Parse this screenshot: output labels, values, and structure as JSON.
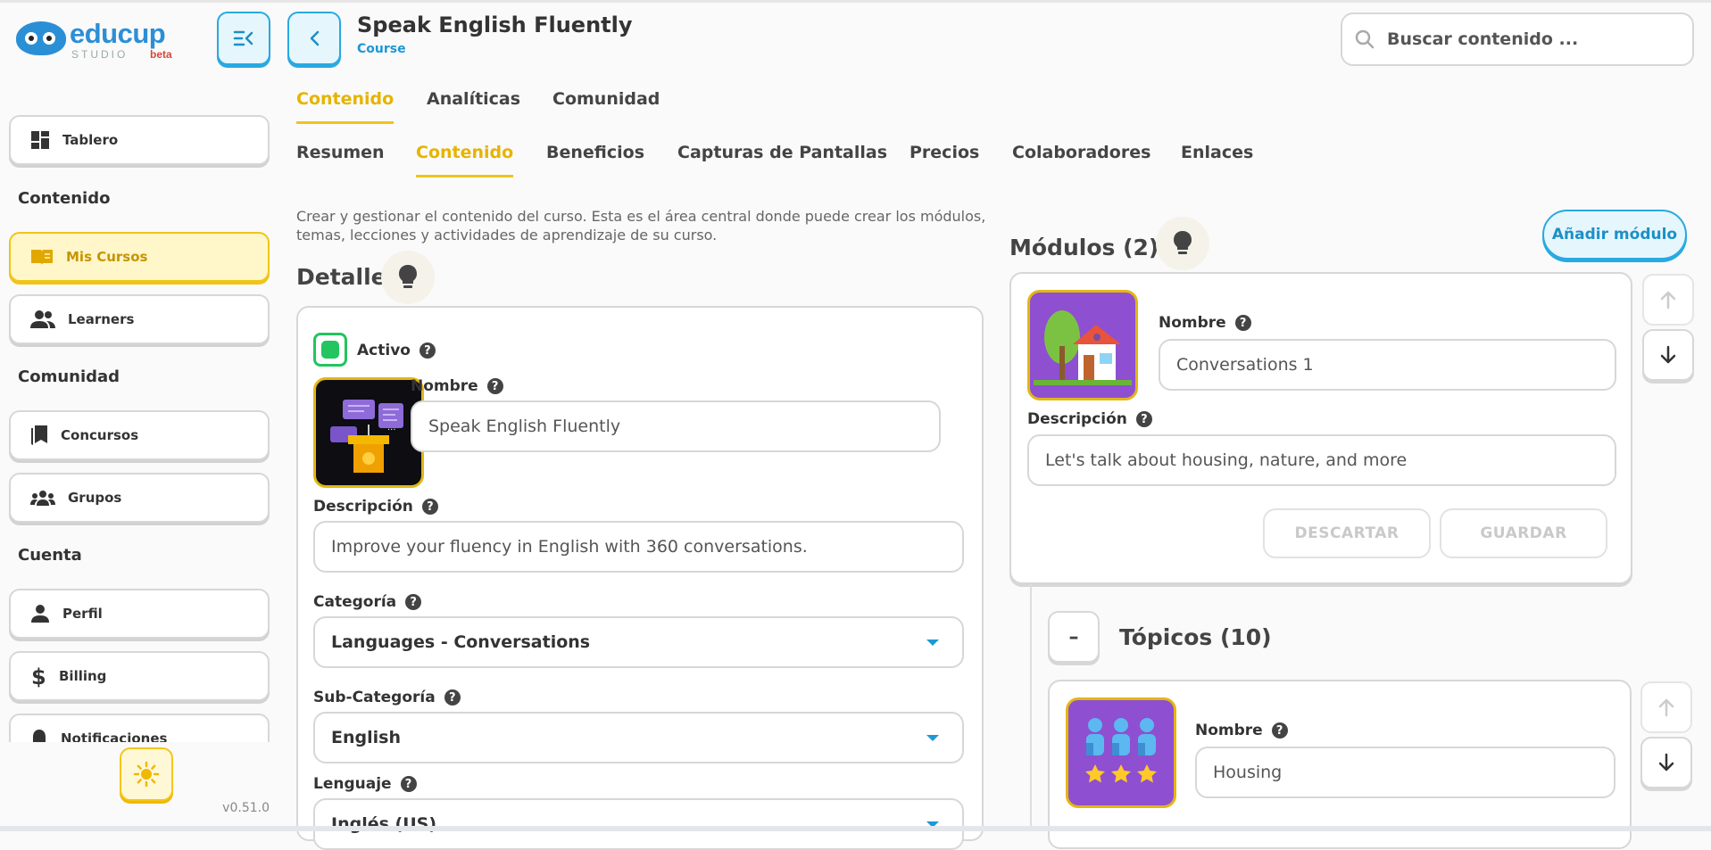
{
  "app": {
    "logo_text": "educup",
    "logo_sub": "STUDIO",
    "logo_badge": "beta",
    "version": "v0.51.0"
  },
  "header": {
    "title": "Speak English Fluently",
    "subtitle": "Course",
    "search_placeholder": "Buscar contenido ..."
  },
  "sidebar": {
    "items": [
      {
        "label": "Tablero",
        "icon": "dashboard-icon"
      },
      {
        "section": "Contenido"
      },
      {
        "label": "Mis Cursos",
        "icon": "book-icon",
        "active": true
      },
      {
        "label": "Learners",
        "icon": "people-icon"
      },
      {
        "section": "Comunidad"
      },
      {
        "label": "Concursos",
        "icon": "bookmark-icon"
      },
      {
        "label": "Grupos",
        "icon": "groups-icon"
      },
      {
        "section": "Cuenta"
      },
      {
        "label": "Perfil",
        "icon": "person-icon"
      },
      {
        "label": "Billing",
        "icon": "dollar-icon"
      },
      {
        "label": "Notificaciones",
        "icon": "bell-icon"
      }
    ]
  },
  "tabs": [
    "Contenido",
    "Analíticas",
    "Comunidad"
  ],
  "subtabs": [
    "Resumen",
    "Contenido",
    "Beneficios",
    "Capturas de Pantallas",
    "Precios",
    "Colaboradores",
    "Enlaces"
  ],
  "description": "Crear y gestionar el contenido del curso. Esta es el área central donde puede crear los módulos, temas, lecciones y actividades de aprendizaje de su curso.",
  "details": {
    "heading": "Detalles",
    "active_label": "Activo",
    "name_label": "Nombre",
    "name_value": "Speak English Fluently",
    "description_label": "Descripción",
    "description_value": "Improve your fluency in English with 360 conversations.",
    "category_label": "Categoría",
    "category_value": "Languages - Conversations",
    "subcategory_label": "Sub-Categoría",
    "subcategory_value": "English",
    "language_label": "Lenguaje",
    "language_value": "Inglés (US)"
  },
  "modules": {
    "heading": "Módulos (2)",
    "add_label": "Añadir módulo",
    "module": {
      "name_label": "Nombre",
      "name_value": "Conversations 1",
      "description_label": "Descripción",
      "description_value": "Let's talk about housing, nature, and more",
      "discard_label": "DESCARTAR",
      "save_label": "GUARDAR"
    },
    "topics_heading": "Tópicos (10)",
    "collapse_symbol": "–",
    "topic": {
      "name_label": "Nombre",
      "name_value": "Housing"
    }
  },
  "colors": {
    "accent_yellow": "#f0c419",
    "accent_blue": "#29a9e1",
    "active_green": "#22c55e",
    "thumb_purple": "#8e4fd1"
  }
}
